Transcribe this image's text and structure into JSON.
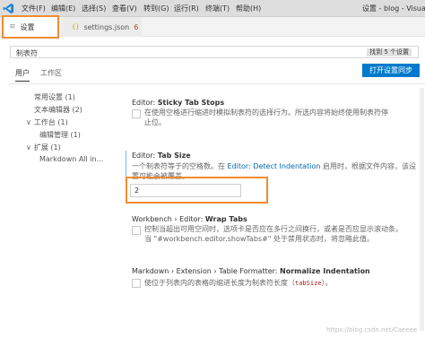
{
  "titlebar": {
    "menus": [
      "文件(F)",
      "编辑(E)",
      "选择(S)",
      "查看(V)",
      "转到(G)",
      "运行(R)",
      "终端(T)",
      "帮助(H)"
    ],
    "title": "设置 - blog - Visual S"
  },
  "tabs": [
    {
      "label": "设置",
      "icon": "settings-lines-icon"
    },
    {
      "label": "settings.json",
      "badge": "6",
      "icon": "json-braces-icon"
    }
  ],
  "search": {
    "value": "制表符",
    "result_count": "找到 5 个设置"
  },
  "scope_tabs": {
    "user": "用户",
    "workspace": "工作区"
  },
  "sync_button": "打开设置同步",
  "toc": [
    {
      "label": "常用设置 (1)",
      "expanded": null
    },
    {
      "label": "文本编辑器 (2)",
      "expanded": null
    },
    {
      "label": "工作台 (1)",
      "expanded": true
    },
    {
      "label": "编辑管理 (1)",
      "expanded": null
    },
    {
      "label": "扩展 (1)",
      "expanded": true
    },
    {
      "label": "Markdown All in...",
      "expanded": null
    }
  ],
  "settings": {
    "sticky": {
      "prefix": "Editor: ",
      "title": "Sticky Tab Stops",
      "desc1": "在使用空格进行缩进时模拟制表符的选择行为。所选内容将始终使用制表符停",
      "desc2": "止位。"
    },
    "tabsize": {
      "prefix": "Editor: ",
      "title": "Tab Size",
      "desc1_a": "一个制表符等于的空格数。在 ",
      "desc1_link": "Editor: Detect Indentation",
      "desc1_b": " 启用时，根据文件内容，该设",
      "desc2": "置可能会被覆盖。",
      "value": "2"
    },
    "wraptabs": {
      "prefix": "Workbench › Editor: ",
      "title": "Wrap Tabs",
      "desc1": "控制当超出可用空间时，选项卡是否应在多行之间换行，或者是否应显示滚动条。",
      "desc2": "当 \"#workbench.editor.showTabs#\" 处于禁用状态时，将忽略此值。"
    },
    "normalize": {
      "prefix": "Markdown › Extension › Table Formatter: ",
      "title": "Normalize Indentation",
      "desc_a": "使位于列表内的表格的缩进长度为制表符长度（",
      "desc_code": "tabSize",
      "desc_b": "）。"
    }
  },
  "watermark": "https://blog.csdn.net/Caeeee"
}
